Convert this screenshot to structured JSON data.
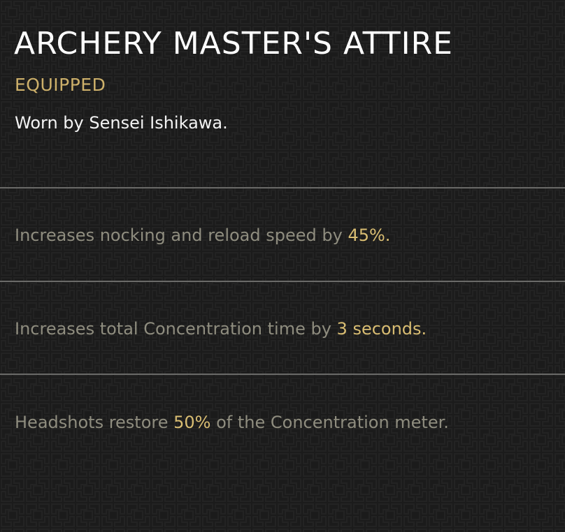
{
  "item": {
    "name": "ARCHERY MASTER'S ATTIRE",
    "status": "EQUIPPED",
    "description": "Worn by Sensei Ishikawa."
  },
  "perks": [
    {
      "pre": "Increases nocking and reload speed by ",
      "value": "45%.",
      "post": ""
    },
    {
      "pre": "Increases total Concentration time by ",
      "value": "3 seconds.",
      "post": ""
    },
    {
      "pre": "Headshots restore ",
      "value": "50%",
      "post": " of the Concentration meter."
    }
  ],
  "colors": {
    "background": "#1b1b1b",
    "title": "#ffffff",
    "status_gold": "#cdb06a",
    "perk_text": "#8f8d7f",
    "highlight_gold": "#d9bd72",
    "divider": "#6a6a68"
  }
}
